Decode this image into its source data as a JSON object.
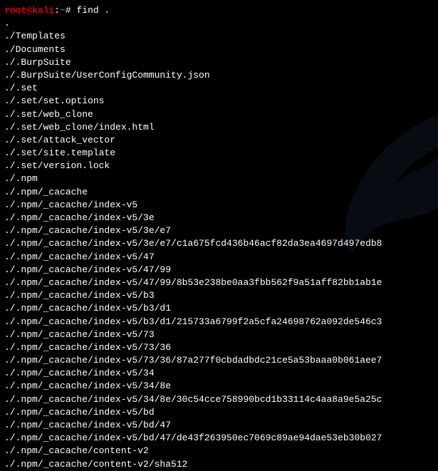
{
  "prompt": {
    "user": "root",
    "at": "@",
    "host": "kali",
    "colon": ":",
    "path": "~",
    "hash": "#",
    "command": "find ."
  },
  "output": [
    ".",
    "./Templates",
    "./Documents",
    "./.BurpSuite",
    "./.BurpSuite/UserConfigCommunity.json",
    "./.set",
    "./.set/set.options",
    "./.set/web_clone",
    "./.set/web_clone/index.html",
    "./.set/attack_vector",
    "./.set/site.template",
    "./.set/version.lock",
    "./.npm",
    "./.npm/_cacache",
    "./.npm/_cacache/index-v5",
    "./.npm/_cacache/index-v5/3e",
    "./.npm/_cacache/index-v5/3e/e7",
    "./.npm/_cacache/index-v5/3e/e7/c1a675fcd436b46acf82da3ea4697d497edb8",
    "./.npm/_cacache/index-v5/47",
    "./.npm/_cacache/index-v5/47/99",
    "./.npm/_cacache/index-v5/47/99/8b53e238be0aa3fbb562f9a51aff82bb1ab1e",
    "./.npm/_cacache/index-v5/b3",
    "./.npm/_cacache/index-v5/b3/d1",
    "./.npm/_cacache/index-v5/b3/d1/215733a6799f2a5cfa24698762a092de546c3",
    "./.npm/_cacache/index-v5/73",
    "./.npm/_cacache/index-v5/73/36",
    "./.npm/_cacache/index-v5/73/36/87a277f0cbdadbdc21ce5a53baaa0b061aee7",
    "./.npm/_cacache/index-v5/34",
    "./.npm/_cacache/index-v5/34/8e",
    "./.npm/_cacache/index-v5/34/8e/30c54cce758990bcd1b33114c4aa8a9e5a25c",
    "./.npm/_cacache/index-v5/bd",
    "./.npm/_cacache/index-v5/bd/47",
    "./.npm/_cacache/index-v5/bd/47/de43f263950ec7069c89ae94dae53eb30b027",
    "./.npm/_cacache/content-v2",
    "./.npm/_cacache/content-v2/sha512"
  ]
}
